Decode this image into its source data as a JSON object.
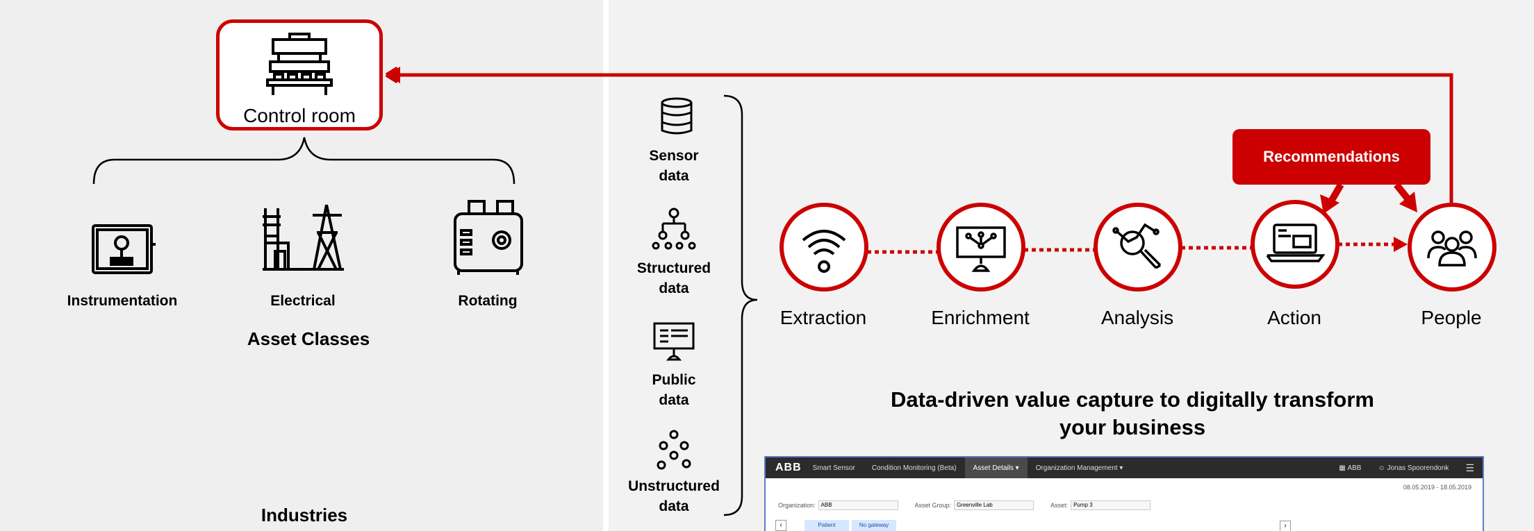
{
  "control_room": {
    "label": "Control room"
  },
  "asset_classes": {
    "title": "Asset Classes",
    "items": [
      {
        "label": "Instrumentation",
        "icon": "instrumentation-icon"
      },
      {
        "label": "Electrical",
        "icon": "electrical-icon"
      },
      {
        "label": "Rotating",
        "icon": "rotating-icon"
      }
    ]
  },
  "industries": {
    "title": "Industries",
    "icons": [
      "factory-icon",
      "solar-power-icon",
      "processing-plant-icon",
      "offshore-rig-icon",
      "wind-turbine-icon"
    ]
  },
  "data_sources": [
    {
      "line1": "Sensor",
      "line2": "data",
      "icon": "database-icon"
    },
    {
      "line1": "Structured",
      "line2": "data",
      "icon": "hierarchy-icon"
    },
    {
      "line1": "Public",
      "line2": "data",
      "icon": "public-display-icon"
    },
    {
      "line1": "Unstructured",
      "line2": "data",
      "icon": "scattered-dots-icon"
    }
  ],
  "process_steps": [
    {
      "label": "Extraction",
      "icon": "wireless-icon"
    },
    {
      "label": "Enrichment",
      "icon": "network-screen-icon"
    },
    {
      "label": "Analysis",
      "icon": "magnifier-chart-icon"
    },
    {
      "label": "Action",
      "icon": "laptop-icon"
    },
    {
      "label": "People",
      "icon": "people-icon"
    }
  ],
  "recommendations": {
    "label": "Recommendations"
  },
  "headline": {
    "line1": "Data-driven value capture to digitally transform",
    "line2": "your business"
  },
  "dashboard": {
    "logo": "ABB",
    "product": "Smart Sensor",
    "menu": [
      "Condition Monitoring (Beta)",
      "Asset Details ▾",
      "Organization Management ▾"
    ],
    "active_menu_index": 1,
    "user_org": "ABB",
    "user_name": "Jonas Spoorendonk",
    "date_range": "08.05.2019 - 18.05.2019",
    "filters": [
      {
        "label": "Organization:",
        "value": "ABB"
      },
      {
        "label": "Asset Group:",
        "value": "Greenville Lab"
      },
      {
        "label": "Asset:",
        "value": "Pump 3"
      }
    ],
    "tabs": [
      "Patient",
      "No gateway"
    ]
  },
  "colors": {
    "accent": "#cc0000",
    "panel": "#efefef",
    "dashboard_bar": "#2b2b2b"
  }
}
